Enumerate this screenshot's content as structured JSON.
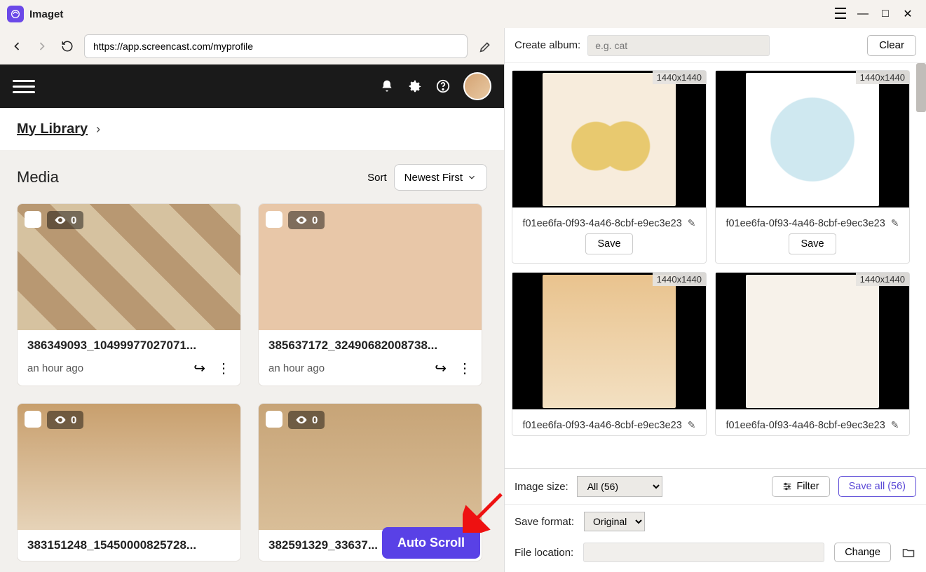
{
  "app": {
    "title": "Imaget"
  },
  "browser": {
    "url": "https://app.screencast.com/myprofile"
  },
  "site": {
    "breadcrumb": "My Library",
    "media_title": "Media",
    "sort_label": "Sort",
    "sort_value": "Newest First",
    "cards": [
      {
        "title": "386349093_10499977027071...",
        "time": "an hour ago",
        "views": "0"
      },
      {
        "title": "385637172_32490682008738...",
        "time": "an hour ago",
        "views": "0"
      },
      {
        "title": "383151248_15450000825728...",
        "time": "",
        "views": "0"
      },
      {
        "title": "382591329_33637...",
        "time": "",
        "views": "0"
      }
    ]
  },
  "auto_scroll": "Auto Scroll",
  "right": {
    "create_album_label": "Create album:",
    "album_placeholder": "e.g. cat",
    "clear": "Clear",
    "items": [
      {
        "dim": "1440x1440",
        "name": "f01ee6fa-0f93-4a46-8cbf-e9ec3e23",
        "save": "Save"
      },
      {
        "dim": "1440x1440",
        "name": "f01ee6fa-0f93-4a46-8cbf-e9ec3e23",
        "save": "Save"
      },
      {
        "dim": "1440x1440",
        "name": "f01ee6fa-0f93-4a46-8cbf-e9ec3e23",
        "save": ""
      },
      {
        "dim": "1440x1440",
        "name": "f01ee6fa-0f93-4a46-8cbf-e9ec3e23",
        "save": ""
      }
    ],
    "image_size_label": "Image size:",
    "image_size_value": "All (56)",
    "filter": "Filter",
    "save_all": "Save all (56)",
    "save_format_label": "Save format:",
    "save_format_value": "Original",
    "file_location_label": "File location:",
    "change": "Change"
  }
}
